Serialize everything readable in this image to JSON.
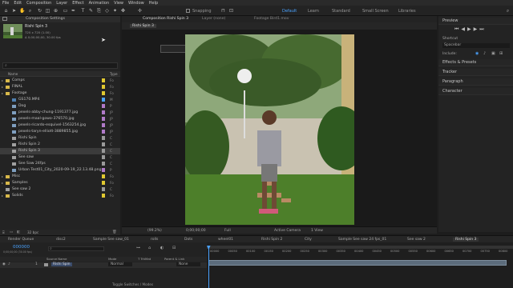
{
  "menu": [
    "File",
    "Edit",
    "Composition",
    "Layer",
    "Effect",
    "Animation",
    "View",
    "Window",
    "Help"
  ],
  "toolbar": {
    "snapping_label": "Snapping",
    "workspaces": [
      "Default",
      "Learn",
      "Standard",
      "Small Screen",
      "Libraries"
    ],
    "active_workspace": "Default",
    "search_icon": "search-icon"
  },
  "project": {
    "tab_label": "Composition Settings",
    "selected_name": "Rishi Spin 3",
    "selected_info_1": "720 x 720 (1.00)",
    "selected_info_2": "Δ 0;00;00;00, 30.00 fps",
    "search_placeholder": "",
    "col_name": "Name",
    "col_type": "Type",
    "items": [
      {
        "name": "Comps",
        "kind": "folder",
        "type": "Fo",
        "label_color": "#e0c830",
        "indent": 0
      },
      {
        "name": "FINAL",
        "kind": "folder",
        "type": "Fo",
        "label_color": "#e0c830",
        "indent": 0
      },
      {
        "name": "Footage",
        "kind": "folder",
        "type": "Fo",
        "label_color": "#e0c830",
        "indent": 0
      },
      {
        "name": "GS170.MP4",
        "kind": "video",
        "type": "M",
        "label_color": "#4aa3ff",
        "indent": 1
      },
      {
        "name": "Dog",
        "kind": "image",
        "type": "P",
        "label_color": "#b07ac8",
        "indent": 1
      },
      {
        "name": "pexels-abby-chung-1191377.jpg",
        "kind": "image",
        "type": "JP",
        "label_color": "#b07ac8",
        "indent": 1
      },
      {
        "name": "pexels-maal-gowo-376570.jpg",
        "kind": "image",
        "type": "JP",
        "label_color": "#b07ac8",
        "indent": 1
      },
      {
        "name": "pexels-ricardo-esquivel-1563254.jpg",
        "kind": "image",
        "type": "JP",
        "label_color": "#b07ac8",
        "indent": 1
      },
      {
        "name": "pexels-taryn-elliott-3889855.jpg",
        "kind": "image",
        "type": "JP",
        "label_color": "#b07ac8",
        "indent": 1
      },
      {
        "name": "Rishi Spin",
        "kind": "comp",
        "type": "C",
        "label_color": "#9a9a9a",
        "indent": 1
      },
      {
        "name": "Rishi Spin 2",
        "kind": "comp",
        "type": "C",
        "label_color": "#9a9a9a",
        "indent": 1
      },
      {
        "name": "Rishi Spin 3",
        "kind": "comp",
        "type": "C",
        "label_color": "#9a9a9a",
        "indent": 1,
        "selected": true
      },
      {
        "name": "See saw",
        "kind": "comp",
        "type": "C",
        "label_color": "#9a9a9a",
        "indent": 1
      },
      {
        "name": "See Saw 24fps",
        "kind": "comp",
        "type": "C",
        "label_color": "#9a9a9a",
        "indent": 1
      },
      {
        "name": "Urban Test01_City_2020-09-19_22.13.48.png",
        "kind": "image",
        "type": "P",
        "label_color": "#b07ac8",
        "indent": 1
      },
      {
        "name": "Misc",
        "kind": "folder",
        "type": "Fo",
        "label_color": "#e0c830",
        "indent": 0
      },
      {
        "name": "Samples",
        "kind": "folder",
        "type": "Fo",
        "label_color": "#e0c830",
        "indent": 0
      },
      {
        "name": "See saw 2",
        "kind": "comp",
        "type": "C",
        "label_color": "#9a9a9a",
        "indent": 0
      },
      {
        "name": "Solids",
        "kind": "folder",
        "type": "Fo",
        "label_color": "#e0c830",
        "indent": 0
      }
    ],
    "footer_bpc": "32 bpc"
  },
  "composition": {
    "top_tabs": [
      "Composition Rishi Spin 3",
      "Layer (none)",
      "Footage Bird1.mov"
    ],
    "sub_tab": "Rishi Spin 3",
    "zoom": "(99.2%)",
    "timecode": "0;00;00;00",
    "resolution": "Full",
    "camera": "Active Camera",
    "view": "1 View"
  },
  "right_panels": {
    "preview": "Preview",
    "shortcut_label": "Shortcut",
    "shortcut_value": "Spacebar",
    "include_label": "Include:",
    "effects": "Effects & Presets",
    "tracker": "Tracker",
    "paragraph": "Paragraph",
    "character": "Character"
  },
  "timeline": {
    "tabs": [
      "Render Queue",
      "disc2",
      "Sample See saw_01",
      "rolls",
      "Dots",
      "wheel01",
      "Rishi Spin 2",
      "City",
      "Sample See saw 24 fps_01",
      "See saw 2",
      "Rishi Spin 3"
    ],
    "active_tab": "Rishi Spin 3",
    "timecode": "000000",
    "timecode_sub": "0;00;00;00 (30.00 fps)",
    "col_source": "Source Name",
    "col_mode": "Mode",
    "col_trkmat": "T TrkMat",
    "col_parent": "Parent & Link",
    "layer_num": "1",
    "layer_name": "Rishi Spin",
    "layer_mode": "Normal",
    "layer_parent": "None",
    "ruler": [
      "00000",
      "00050",
      "00100",
      "00150",
      "00200",
      "00250",
      "00300",
      "00350",
      "00400",
      "00450",
      "00500",
      "00550",
      "00600",
      "00650",
      "00700",
      "00750",
      "00800"
    ],
    "footer": "Toggle Switches / Modes"
  }
}
